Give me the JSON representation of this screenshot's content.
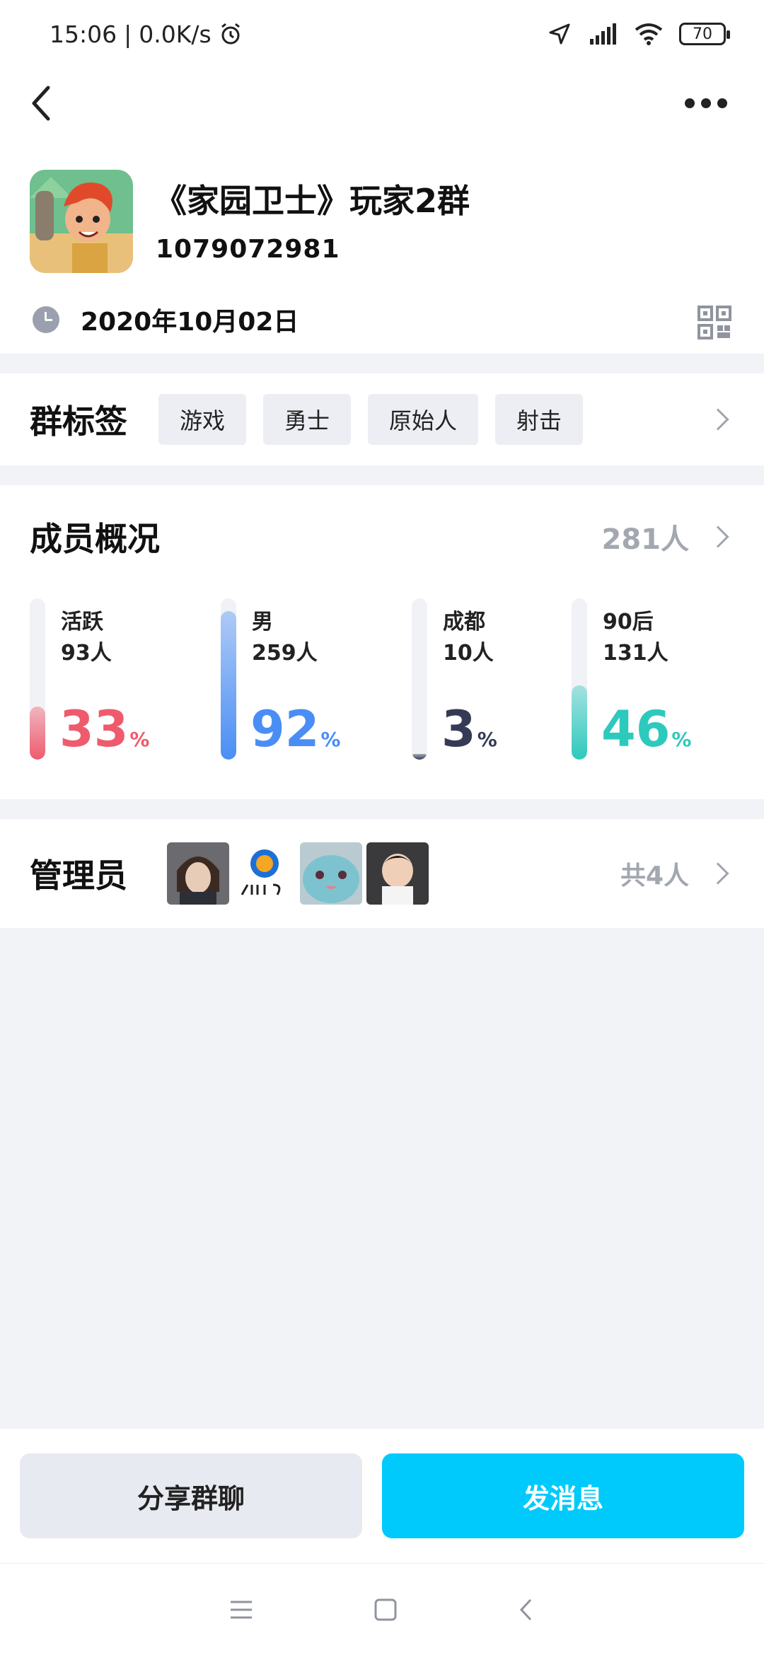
{
  "status_bar": {
    "time": "15:06",
    "speed": "0.0K/s",
    "battery": "70"
  },
  "group": {
    "name": "《家园卫士》玩家2群",
    "id": "1079072981",
    "created": "2020年10月02日"
  },
  "tags_section": {
    "title": "群标签",
    "tags": [
      "游戏",
      "勇士",
      "原始人",
      "射击"
    ]
  },
  "members": {
    "title": "成员概况",
    "count": "281人",
    "stats": [
      {
        "label": "活跃",
        "sub": "93人",
        "pct": "33",
        "fill": 0.33,
        "color": "#ee5b6d"
      },
      {
        "label": "男",
        "sub": "259人",
        "pct": "92",
        "fill": 0.92,
        "color": "#4a8ef5"
      },
      {
        "label": "成都",
        "sub": "10人",
        "pct": "3",
        "fill": 0.03,
        "color": "#353b55"
      },
      {
        "label": "90后",
        "sub": "131人",
        "pct": "46",
        "fill": 0.46,
        "color": "#2ec9bd"
      }
    ],
    "pct_unit": "%"
  },
  "admins": {
    "title": "管理员",
    "total": "共4人"
  },
  "actions": {
    "share": "分享群聊",
    "send": "发消息"
  },
  "icons": {
    "back": "back-chevron-icon",
    "more": "more-dots-icon",
    "qr": "qr-code-icon",
    "clock": "clock-icon"
  }
}
